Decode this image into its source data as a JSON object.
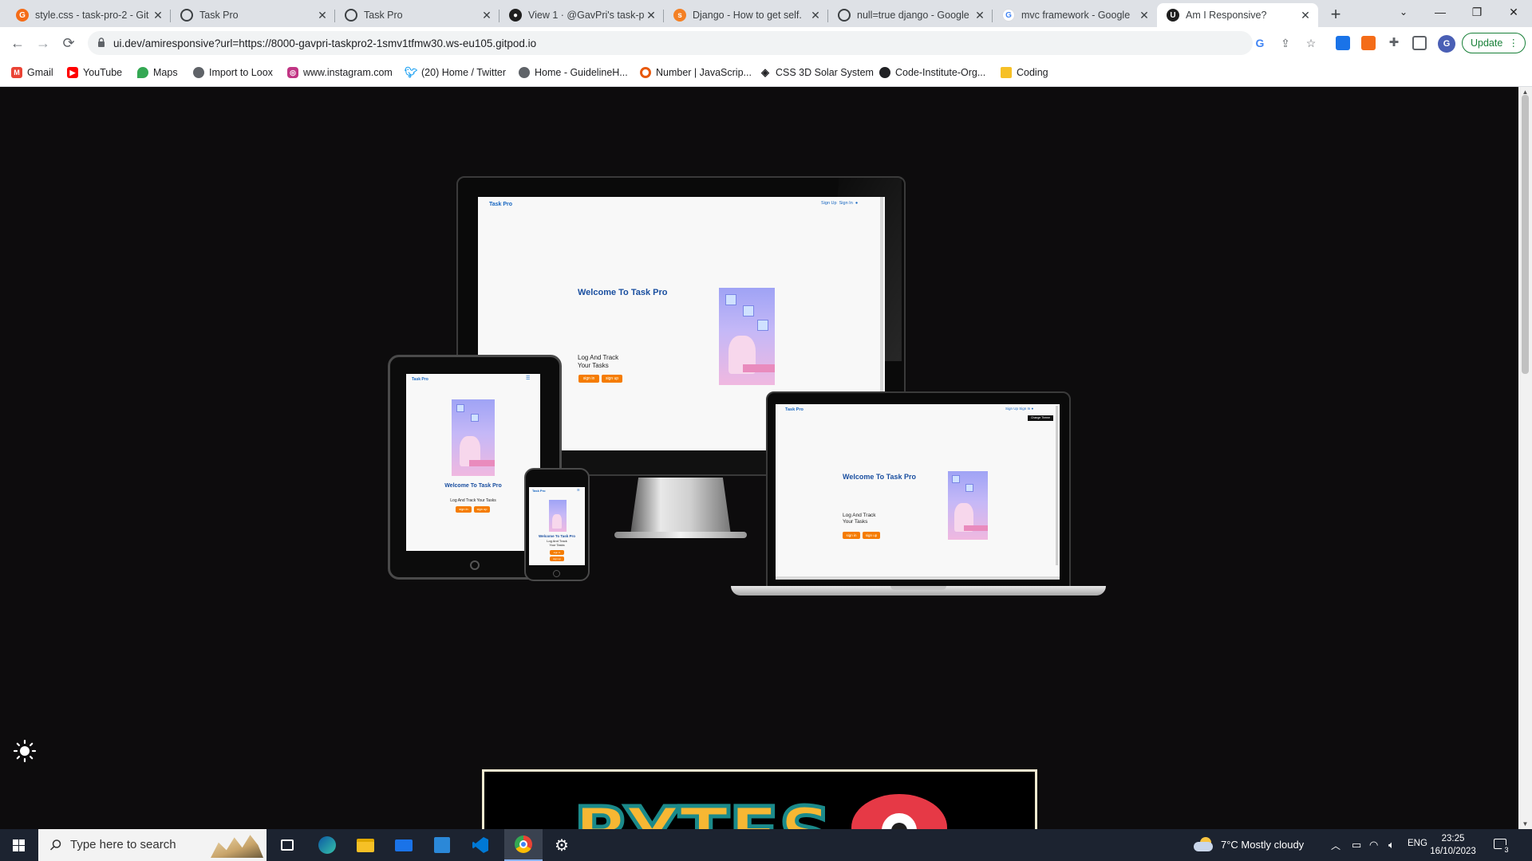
{
  "browser": {
    "tabs": [
      {
        "title": "style.css - task-pro-2 - Git",
        "active": false
      },
      {
        "title": "Task Pro",
        "active": false
      },
      {
        "title": "Task Pro",
        "active": false
      },
      {
        "title": "View 1 · @GavPri's task-p",
        "active": false
      },
      {
        "title": "Django - How to get self.",
        "active": false
      },
      {
        "title": "null=true django - Google",
        "active": false
      },
      {
        "title": "mvc framework - Google",
        "active": false
      },
      {
        "title": "Am I Responsive?",
        "active": true
      }
    ],
    "url": "ui.dev/amiresponsive?url=https://8000-gavpri-taskpro2-1smv1tfmw30.ws-eu105.gitpod.io",
    "update_label": "Update",
    "profile_initial": "G"
  },
  "bookmarks": [
    {
      "label": "Gmail",
      "icon": "gmail-icon",
      "color": "#ea4335"
    },
    {
      "label": "YouTube",
      "icon": "youtube-icon",
      "color": "#ff0000"
    },
    {
      "label": "Maps",
      "icon": "maps-icon",
      "color": "#34a853"
    },
    {
      "label": "Import to Loox",
      "icon": "globe-icon",
      "color": "#5f6368"
    },
    {
      "label": "www.instagram.com",
      "icon": "instagram-icon",
      "color": "#c13584"
    },
    {
      "label": "(20) Home / Twitter",
      "icon": "twitter-icon",
      "color": "#1da1f2"
    },
    {
      "label": "Home - GuidelineH...",
      "icon": "globe-icon",
      "color": "#5f6368"
    },
    {
      "label": "Number | JavaScrip...",
      "icon": "circle-icon",
      "color": "#e8590c"
    },
    {
      "label": "CSS 3D Solar System",
      "icon": "codepen-icon",
      "color": "#202124"
    },
    {
      "label": "Code-Institute-Org...",
      "icon": "github-icon",
      "color": "#202124"
    },
    {
      "label": "Coding",
      "icon": "folder-icon",
      "color": "#f6c026"
    }
  ],
  "mockup": {
    "brand": "Task Pro",
    "nav_signup": "Sign Up",
    "nav_signin": "Sign In",
    "heading": "Welcome To Task Pro",
    "tagline_line1": "Log And Track",
    "tagline_line2": "Your Tasks",
    "tagline_full": "Log And Track Your Tasks",
    "btn_signin": "sign in",
    "btn_signup": "sign up",
    "change_theme": "Change Theme"
  },
  "taskbar": {
    "search_placeholder": "Type here to search",
    "weather": "7°C  Mostly cloudy",
    "lang": "ENG",
    "time": "23:25",
    "date": "16/10/2023",
    "notifications": "3"
  },
  "colors": {
    "accent_orange": "#f57c00",
    "brand_blue": "#1565c0",
    "update_green": "#188038"
  }
}
